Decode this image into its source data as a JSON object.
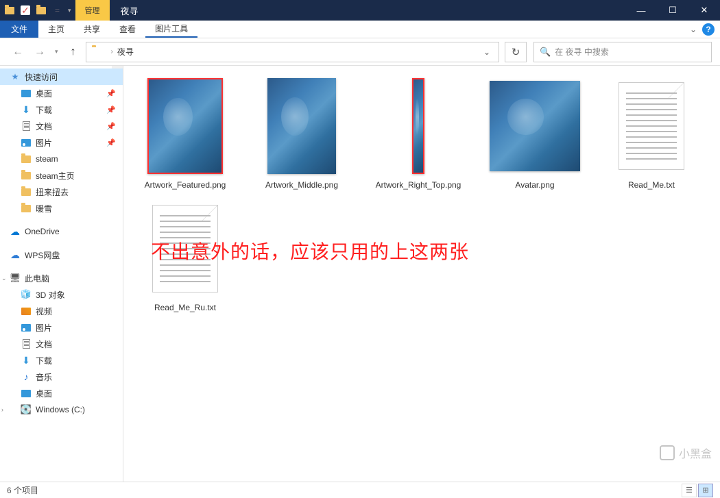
{
  "titlebar": {
    "context_tab": "管理",
    "window_title": "夜寻"
  },
  "menubar": {
    "file": "文件",
    "items": [
      "主页",
      "共享",
      "查看",
      "图片工具"
    ]
  },
  "nav": {
    "breadcrumb": "夜寻",
    "search_placeholder": "在 夜寻 中搜索"
  },
  "sidebar": {
    "quick_access": "快速访问",
    "quick_items": [
      {
        "label": "桌面",
        "icon": "desktop",
        "pinned": true
      },
      {
        "label": "下载",
        "icon": "download",
        "pinned": true
      },
      {
        "label": "文档",
        "icon": "doc",
        "pinned": true
      },
      {
        "label": "图片",
        "icon": "pic",
        "pinned": true
      },
      {
        "label": "steam",
        "icon": "folder"
      },
      {
        "label": "steam主页",
        "icon": "folder"
      },
      {
        "label": "扭来扭去",
        "icon": "folder"
      },
      {
        "label": "暖雪",
        "icon": "folder"
      }
    ],
    "onedrive": "OneDrive",
    "wps": "WPS网盘",
    "this_pc": "此电脑",
    "pc_items": [
      {
        "label": "3D 对象",
        "icon": "3d"
      },
      {
        "label": "视频",
        "icon": "video"
      },
      {
        "label": "图片",
        "icon": "pic"
      },
      {
        "label": "文档",
        "icon": "doc"
      },
      {
        "label": "下载",
        "icon": "download"
      },
      {
        "label": "音乐",
        "icon": "music"
      },
      {
        "label": "桌面",
        "icon": "desktop"
      },
      {
        "label": "Windows (C:)",
        "icon": "drive"
      }
    ]
  },
  "files": [
    {
      "name": "Artwork_Featured.png",
      "type": "image",
      "variant": "featured"
    },
    {
      "name": "Artwork_Middle.png",
      "type": "image",
      "variant": "middle"
    },
    {
      "name": "Artwork_Right_Top.png",
      "type": "image",
      "variant": "righttop"
    },
    {
      "name": "Avatar.png",
      "type": "image",
      "variant": "avatar"
    },
    {
      "name": "Read_Me.txt",
      "type": "text"
    },
    {
      "name": "Read_Me_Ru.txt",
      "type": "text"
    }
  ],
  "annotation": "不出意外的话，应该只用的上这两张",
  "status": {
    "count": "6 个项目"
  },
  "watermark": "小黑盒"
}
